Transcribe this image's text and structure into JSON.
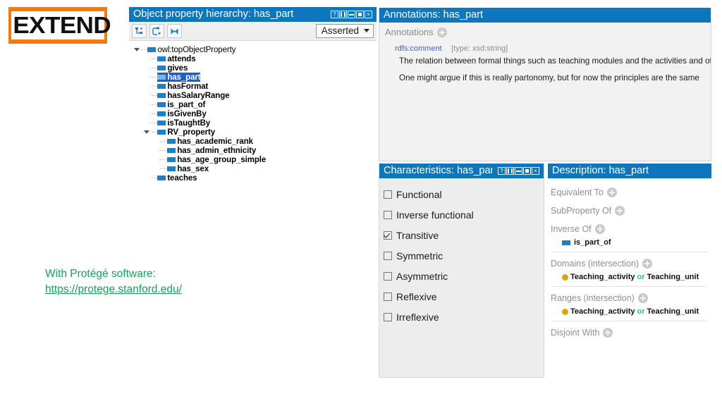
{
  "logo": {
    "text": "EXTEND",
    "frame_color": "#F07D13"
  },
  "caption": {
    "line1": "With Protégé software:",
    "link": "https://protege.stanford.edu/",
    "color": "#18A05A"
  },
  "tree_panel": {
    "title": "Object property hierarchy: has_part",
    "window_controls": [
      "help",
      "split",
      "minimize",
      "maximize",
      "close"
    ],
    "toolbar": {
      "buttons": [
        "add-sub-property-icon",
        "add-sibling-property-icon",
        "delete-property-icon"
      ]
    },
    "view_selector": {
      "value": "Asserted"
    },
    "items": [
      {
        "label": "owl:topObjectProperty",
        "depth": 0,
        "expanded": true,
        "selected": false
      },
      {
        "label": "attends",
        "depth": 1,
        "expanded": false,
        "selected": false
      },
      {
        "label": "gives",
        "depth": 1,
        "expanded": false,
        "selected": false
      },
      {
        "label": "has_part",
        "depth": 1,
        "expanded": false,
        "selected": true
      },
      {
        "label": "hasFormat",
        "depth": 1,
        "expanded": false,
        "selected": false
      },
      {
        "label": "hasSalaryRange",
        "depth": 1,
        "expanded": false,
        "selected": false
      },
      {
        "label": "is_part_of",
        "depth": 1,
        "expanded": false,
        "selected": false
      },
      {
        "label": "isGivenBy",
        "depth": 1,
        "expanded": false,
        "selected": false
      },
      {
        "label": "isTaughtBy",
        "depth": 1,
        "expanded": false,
        "selected": false
      },
      {
        "label": "RV_property",
        "depth": 1,
        "expanded": true,
        "selected": false
      },
      {
        "label": "has_academic_rank",
        "depth": 2,
        "expanded": false,
        "selected": false
      },
      {
        "label": "has_admin_ethnicity",
        "depth": 2,
        "expanded": false,
        "selected": false
      },
      {
        "label": "has_age_group_simple",
        "depth": 2,
        "expanded": false,
        "selected": false
      },
      {
        "label": "has_sex",
        "depth": 2,
        "expanded": false,
        "selected": false
      },
      {
        "label": "teaches",
        "depth": 1,
        "expanded": false,
        "selected": false
      }
    ]
  },
  "annotations_panel": {
    "title": "Annotations: has_part",
    "section_label": "Annotations",
    "annotation": {
      "property": "rdfs:comment",
      "type": "[type: xsd:string]",
      "line1": "The relation between formal things such as teaching modules and the activities and othe",
      "line2": "One might argue if this is really partonomy, but for now the principles are the same"
    }
  },
  "characteristics_panel": {
    "title": "Characteristics: has_part",
    "window_controls": [
      "help",
      "split",
      "minimize",
      "maximize",
      "close"
    ],
    "checkboxes": [
      {
        "label": "Functional",
        "checked": false
      },
      {
        "label": "Inverse functional",
        "checked": false
      },
      {
        "label": "Transitive",
        "checked": true
      },
      {
        "label": "Symmetric",
        "checked": false
      },
      {
        "label": "Asymmetric",
        "checked": false
      },
      {
        "label": "Reflexive",
        "checked": false
      },
      {
        "label": "Irreflexive",
        "checked": false
      }
    ]
  },
  "description_panel": {
    "title": "Description: has_part",
    "sections": [
      {
        "label": "Equivalent To",
        "items": []
      },
      {
        "label": "SubProperty Of",
        "items": []
      },
      {
        "label": "Inverse Of",
        "items": [
          {
            "kind": "property",
            "name": "is_part_of"
          }
        ]
      },
      {
        "label": "Domains (intersection)",
        "items": [
          {
            "kind": "class-expression",
            "left": "Teaching_activity",
            "op": "or",
            "right": "Teaching_unit"
          }
        ]
      },
      {
        "label": "Ranges (intersection)",
        "items": [
          {
            "kind": "class-expression",
            "left": "Teaching_activity",
            "op": "or",
            "right": "Teaching_unit"
          }
        ]
      },
      {
        "label": "Disjoint With",
        "items": []
      }
    ]
  }
}
